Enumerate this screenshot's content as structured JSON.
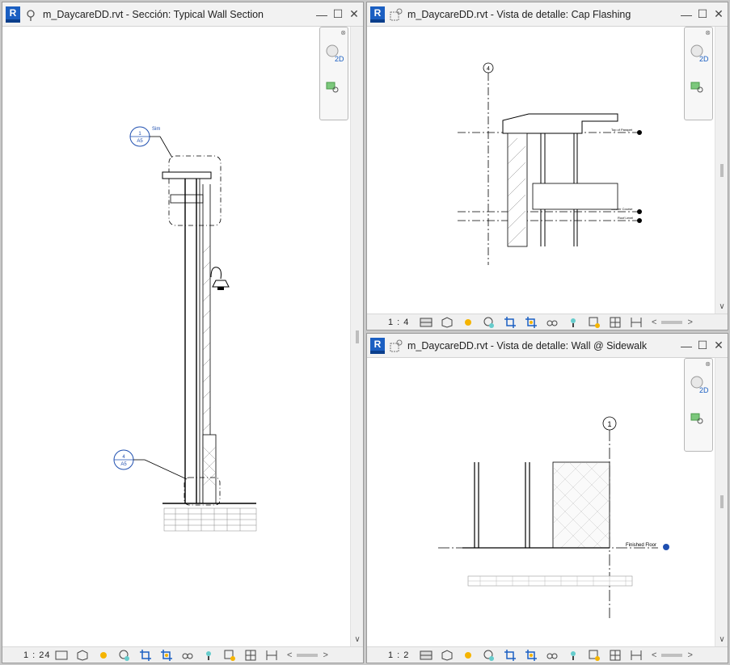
{
  "windows": {
    "section": {
      "title": "m_DaycareDD.rvt - Sección: Typical Wall Section",
      "scale": "1 : 24",
      "tag_top": {
        "num": "1",
        "sheet": "A5",
        "label": "Sim"
      },
      "tag_bottom": {
        "num": "4",
        "sheet": "A5"
      }
    },
    "cap": {
      "title": "m_DaycareDD.rvt - Vista de detalle: Cap Flashing",
      "scale": "1 : 4",
      "grid_label": "4",
      "levels": [
        "Top of Parapet",
        "Soldier Course",
        "Roof Level"
      ]
    },
    "sidewalk": {
      "title": "m_DaycareDD.rvt - Vista de detalle: Wall @ Sidewalk",
      "scale": "1 : 2",
      "grid_label": "1",
      "level": "Finished Floor"
    }
  },
  "app_logo": "R",
  "navbar_label": "2D",
  "colors": {
    "accent": "#1b5fc2",
    "title_bg": "#f2f2f2",
    "line": "#000000"
  }
}
